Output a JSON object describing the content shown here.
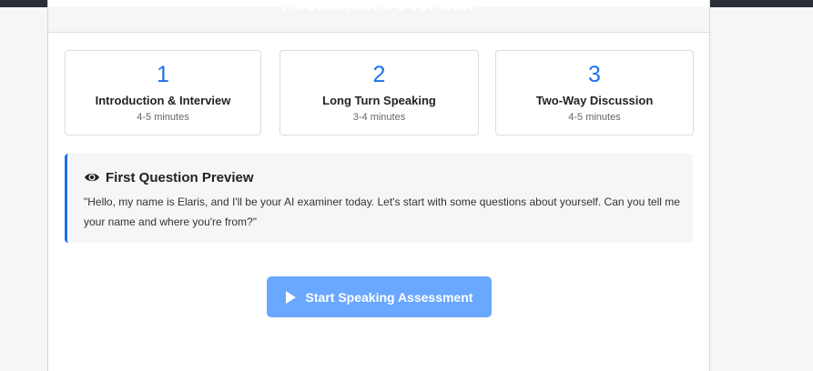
{
  "header": {
    "title": "Assessment Overview"
  },
  "phases": [
    {
      "number": "1",
      "title": "Introduction & Interview",
      "duration": "4-5 minutes"
    },
    {
      "number": "2",
      "title": "Long Turn Speaking",
      "duration": "3-4 minutes"
    },
    {
      "number": "3",
      "title": "Two-Way Discussion",
      "duration": "4-5 minutes"
    }
  ],
  "preview": {
    "icon": "eye-icon",
    "title": "First Question Preview",
    "text": "\"Hello, my name is Elaris, and I'll be your AI examiner today. Let's start with some questions about yourself. Can you tell me your name and where you're from?\""
  },
  "start_button": {
    "icon": "play-icon",
    "label": "Start Speaking Assessment"
  },
  "colors": {
    "accent": "#1a73e8",
    "button": "#6aa7ff"
  }
}
